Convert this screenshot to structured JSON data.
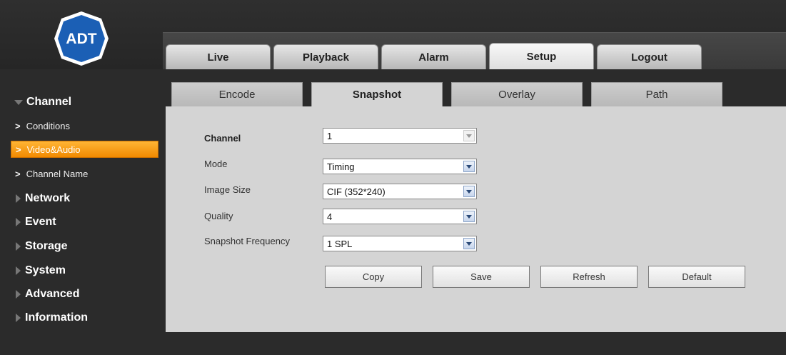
{
  "brand": {
    "logo_text": "ADT"
  },
  "topnav": {
    "tabs": [
      {
        "label": "Live"
      },
      {
        "label": "Playback"
      },
      {
        "label": "Alarm"
      },
      {
        "label": "Setup"
      },
      {
        "label": "Logout"
      }
    ],
    "active": "Setup"
  },
  "sidebar": {
    "sections": [
      {
        "label": "Channel",
        "expanded": true
      },
      {
        "label": "Network"
      },
      {
        "label": "Event"
      },
      {
        "label": "Storage"
      },
      {
        "label": "System"
      },
      {
        "label": "Advanced"
      },
      {
        "label": "Information"
      }
    ],
    "channel_items": [
      {
        "label": "Conditions"
      },
      {
        "label": "Video&Audio"
      },
      {
        "label": "Channel Name"
      }
    ],
    "chevron": ">",
    "active_item": "Video&Audio"
  },
  "subtabs": {
    "tabs": [
      {
        "label": "Encode"
      },
      {
        "label": "Snapshot"
      },
      {
        "label": "Overlay"
      },
      {
        "label": "Path"
      }
    ],
    "active": "Snapshot"
  },
  "form": {
    "channel": {
      "label": "Channel",
      "value": "1"
    },
    "mode": {
      "label": "Mode",
      "value": "Timing"
    },
    "image_size": {
      "label": "Image Size",
      "value": "CIF (352*240)"
    },
    "quality": {
      "label": "Quality",
      "value": "4"
    },
    "snapshot_frequency": {
      "label": "Snapshot Frequency",
      "value": "1 SPL"
    }
  },
  "buttons": {
    "copy": "Copy",
    "save": "Save",
    "refresh": "Refresh",
    "default": "Default"
  },
  "colors": {
    "accent": "#f28a00",
    "logo_blue": "#1b5fb5",
    "background": "#2b2b2b",
    "panel": "#d4d4d4"
  }
}
